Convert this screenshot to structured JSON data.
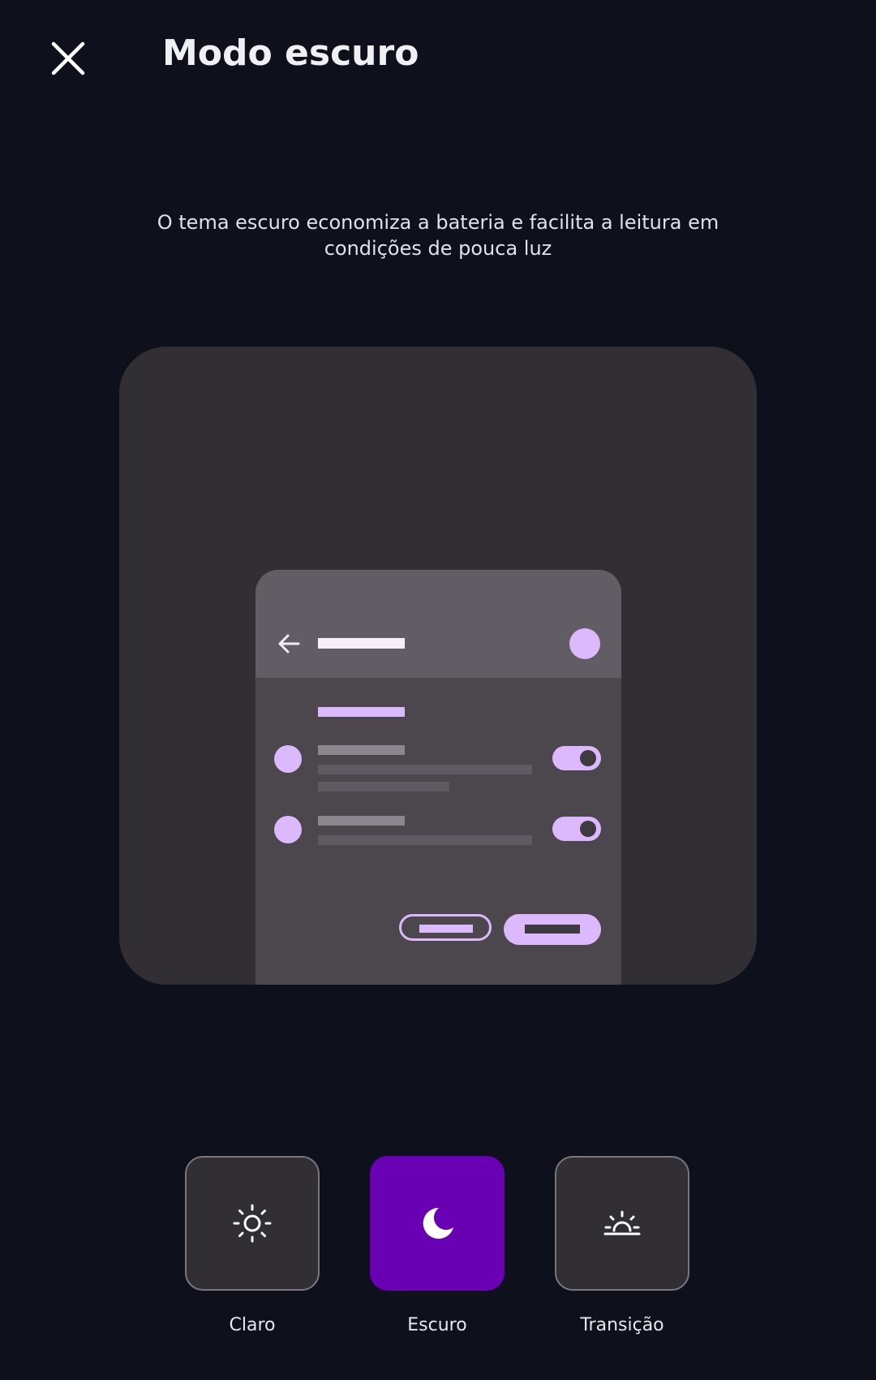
{
  "header": {
    "title": "Modo escuro",
    "close_icon": "close-icon"
  },
  "description": "O tema escuro economiza a bateria e facilita a leitura em condições de pouca luz",
  "preview": {
    "icons": [
      "back-arrow-icon"
    ],
    "colors": {
      "card": "#312e34",
      "phone": "#4b474d",
      "appbar": "#625d64",
      "accent": "#dcb8fc"
    }
  },
  "modes": [
    {
      "label": "Claro",
      "icon": "sun-icon",
      "selected": false
    },
    {
      "label": "Escuro",
      "icon": "moon-icon",
      "selected": true
    },
    {
      "label": "Transição",
      "icon": "sunrise-icon",
      "selected": false
    }
  ],
  "colors": {
    "background": "#0e111b",
    "selected_tile": "#6a00b4",
    "tile": "#312e34",
    "tile_border": "#7a767d"
  }
}
